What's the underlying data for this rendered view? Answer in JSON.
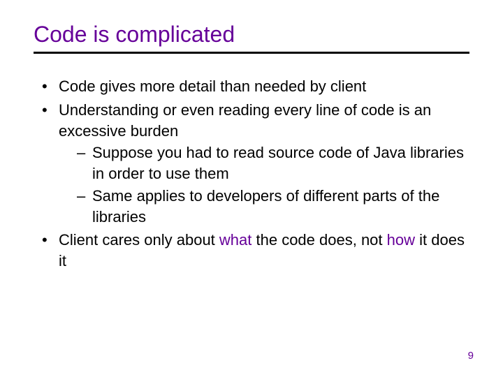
{
  "slide": {
    "title": "Code is complicated",
    "bullets": [
      {
        "text": "Code gives more detail than needed by client"
      },
      {
        "text": "Understanding or even reading every line of code is an excessive burden",
        "sub": [
          "Suppose you had to read source code of Java libraries in order to use them",
          "Same applies to developers of different parts of the libraries"
        ]
      },
      {
        "pre": "Client cares only about ",
        "what": "what",
        "mid": " the code does, not ",
        "how": "how",
        "post": " it does it"
      }
    ],
    "page_number": "9"
  }
}
